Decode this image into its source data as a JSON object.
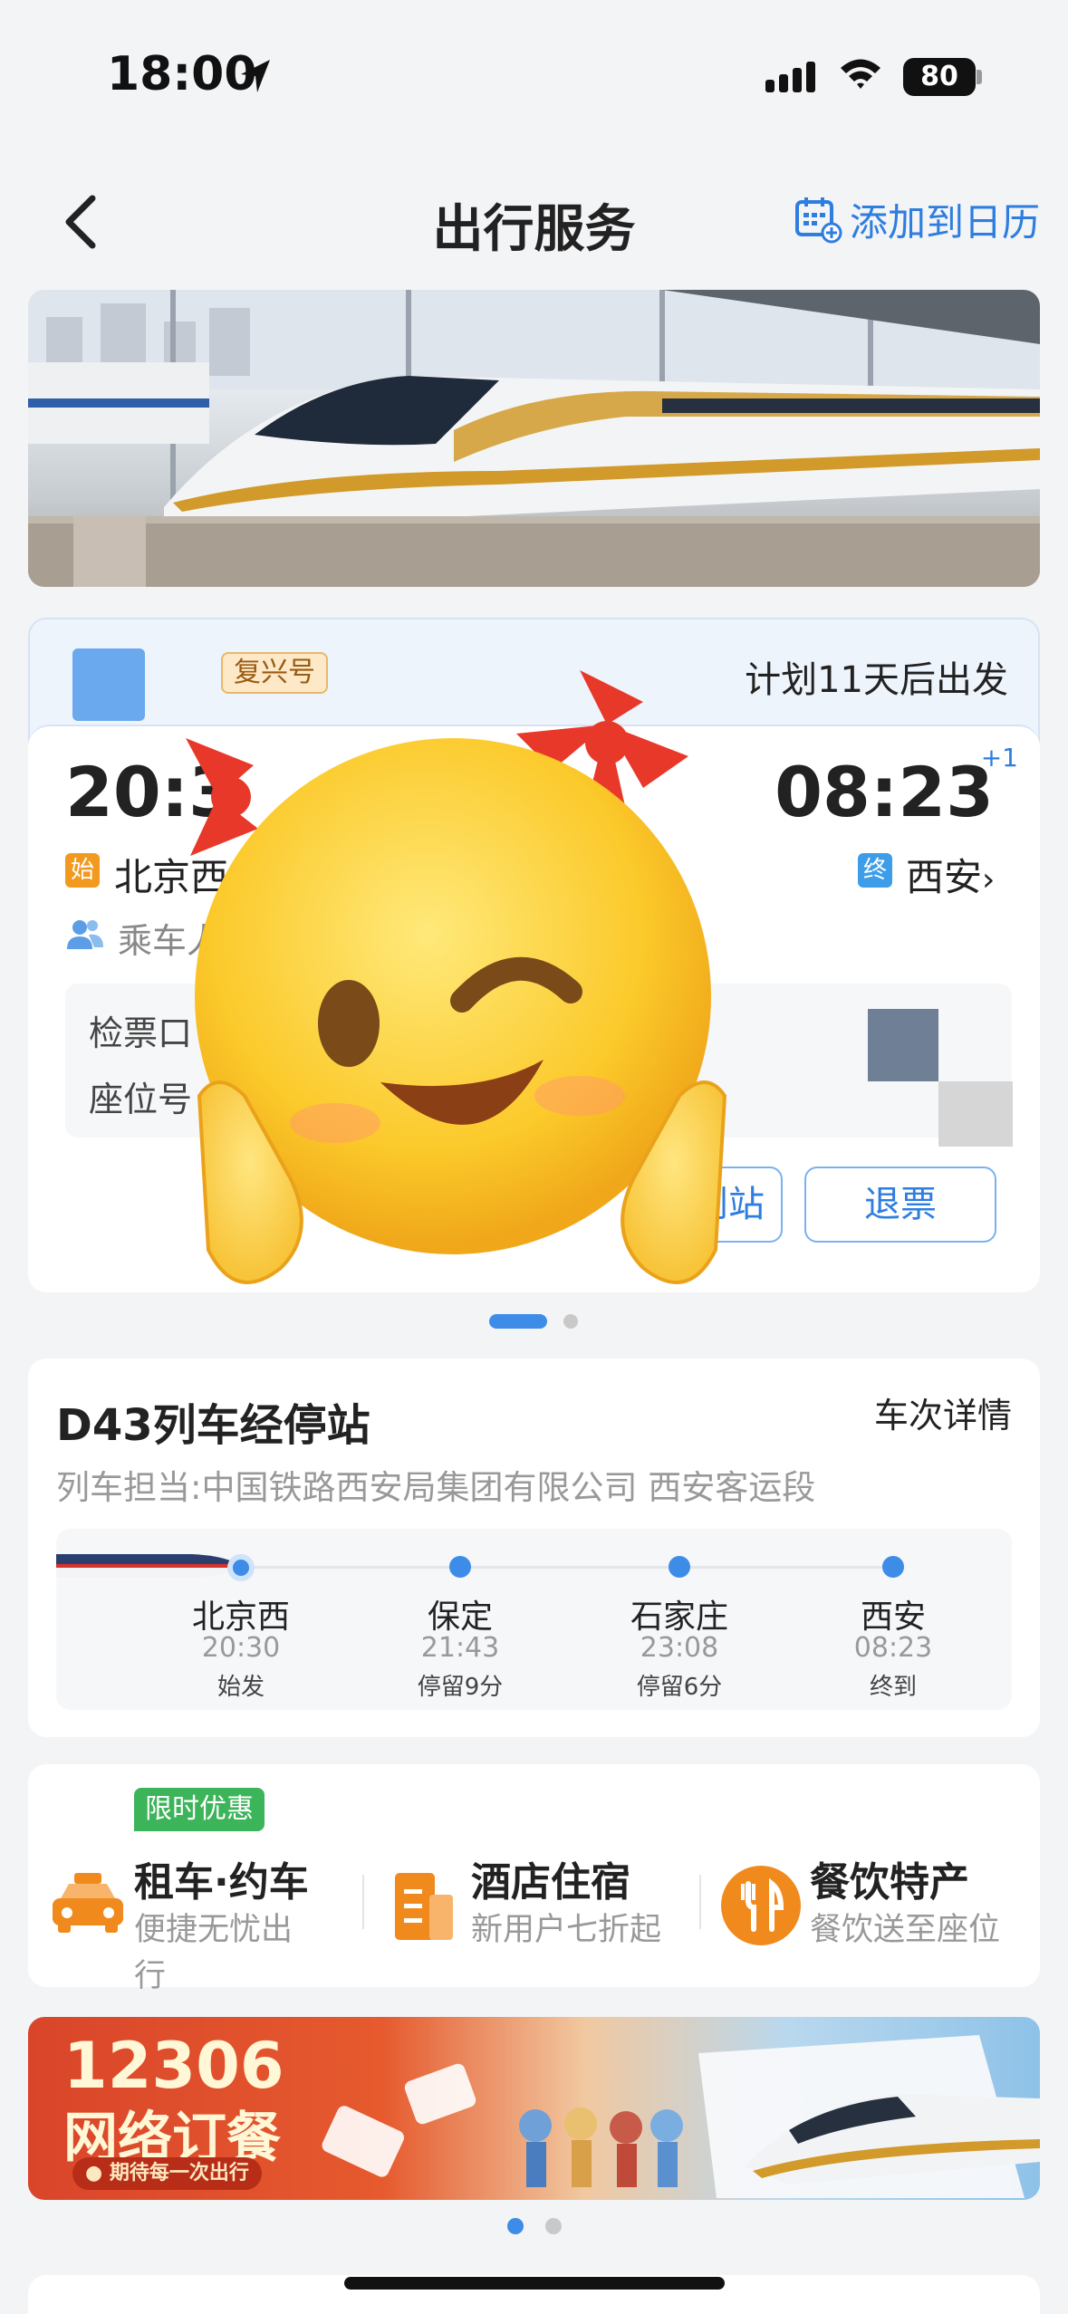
{
  "status_bar": {
    "time": "18:00",
    "battery": "80"
  },
  "nav": {
    "title": "出行服务",
    "add_calendar": "添加到日历"
  },
  "ticket": {
    "train_type": "复兴号",
    "departure_plan": "计划11天后出发",
    "dep_time": "20:3",
    "arr_time": "08:23",
    "day_offset": "+1",
    "start_tag": "始",
    "end_tag": "终",
    "dep_station": "北京西",
    "arr_station": "西安",
    "arr_chevron": "›",
    "passenger_label": "乘车人",
    "check_label": "检票口",
    "seat_label": "座位号",
    "station_button": "到站",
    "refund_button": "退票"
  },
  "stops": {
    "title": "D43列车经停站",
    "detail_link": "车次详情",
    "operator": "列车担当:中国铁路西安局集团有限公司 西安客运段",
    "items": [
      {
        "name": "北京西",
        "time": "20:30",
        "note": "始发"
      },
      {
        "name": "保定",
        "time": "21:43",
        "note": "停留9分"
      },
      {
        "name": "石家庄",
        "time": "23:08",
        "note": "停留6分"
      },
      {
        "name": "西安",
        "time": "08:23",
        "note": "终到"
      }
    ]
  },
  "services": {
    "promo_badge": "限时优惠",
    "items": [
      {
        "title": "租车·约车",
        "sub": "便捷无忧出行",
        "icon": "taxi-icon"
      },
      {
        "title": "酒店住宿",
        "sub": "新用户七折起",
        "icon": "hotel-icon"
      },
      {
        "title": "餐饮特产",
        "sub": "餐饮送至座位",
        "icon": "dining-icon"
      }
    ]
  },
  "ad": {
    "title": "12306",
    "subtitle": "网络订餐",
    "slogan": "● 期待每一次出行"
  },
  "colors": {
    "accent": "#2e7de0",
    "promo": "#3cb45a",
    "orange": "#f19a1f"
  }
}
